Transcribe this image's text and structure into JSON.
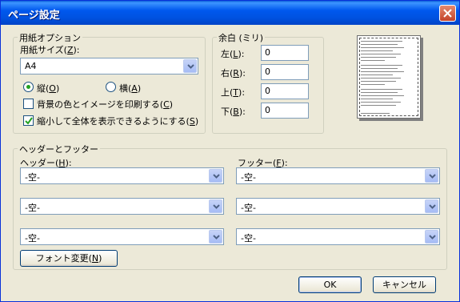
{
  "window": {
    "title": "ページ設定"
  },
  "paper": {
    "group_label": "用紙オプション",
    "size_label_prefix": "用紙サイズ(",
    "size_label_key": "Z",
    "size_label_suffix": "):",
    "size_value": "A4",
    "portrait_prefix": "縦(",
    "portrait_key": "O",
    "portrait_suffix": ")",
    "landscape_prefix": "横(",
    "landscape_key": "A",
    "landscape_suffix": ")",
    "bg_print_prefix": "背景の色とイメージを印刷する(",
    "bg_print_key": "C",
    "bg_print_suffix": ")",
    "shrink_prefix": "縮小して全体を表示できるようにする(",
    "shrink_key": "S",
    "shrink_suffix": ")"
  },
  "margins": {
    "group_label": "余白 (ミリ)",
    "left_prefix": "左(",
    "left_key": "L",
    "left_suffix": "):",
    "left_value": "0",
    "right_prefix": "右(",
    "right_key": "R",
    "right_suffix": "):",
    "right_value": "0",
    "top_prefix": "上(",
    "top_key": "T",
    "top_suffix": "):",
    "top_value": "0",
    "bottom_prefix": "下(",
    "bottom_key": "B",
    "bottom_suffix": "):",
    "bottom_value": "0"
  },
  "headerfooter": {
    "group_label": "ヘッダーとフッター",
    "header_prefix": "ヘッダー(",
    "header_key": "H",
    "header_suffix": "):",
    "footer_prefix": "フッター(",
    "footer_key": "F",
    "footer_suffix": "):",
    "header_values": [
      "-空-",
      "-空-",
      "-空-"
    ],
    "footer_values": [
      "-空-",
      "-空-",
      "-空-"
    ],
    "font_prefix": "フォント変更(",
    "font_key": "N",
    "font_suffix": ")"
  },
  "buttons": {
    "ok": "OK",
    "cancel": "キャンセル"
  }
}
